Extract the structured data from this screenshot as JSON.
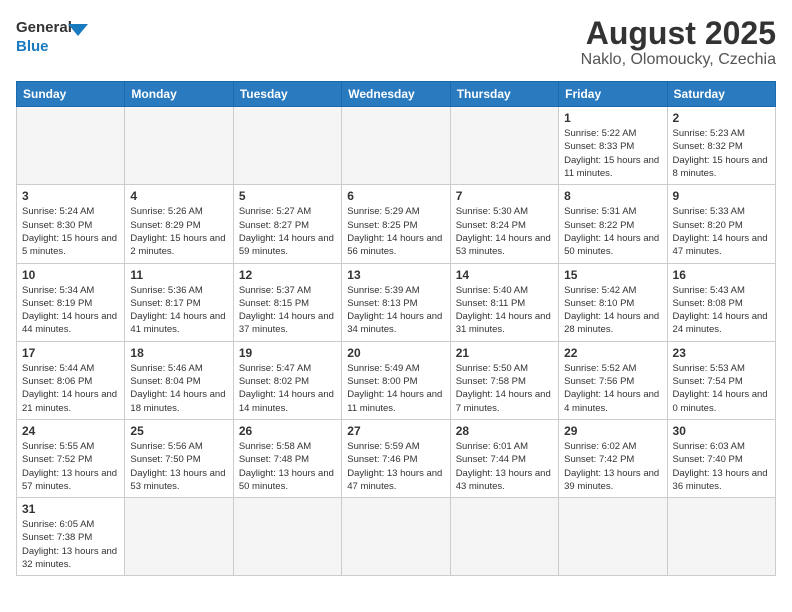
{
  "logo": {
    "general": "General",
    "blue": "Blue"
  },
  "header": {
    "title": "August 2025",
    "subtitle": "Naklo, Olomoucky, Czechia"
  },
  "weekdays": [
    "Sunday",
    "Monday",
    "Tuesday",
    "Wednesday",
    "Thursday",
    "Friday",
    "Saturday"
  ],
  "weeks": [
    [
      {
        "day": "",
        "info": ""
      },
      {
        "day": "",
        "info": ""
      },
      {
        "day": "",
        "info": ""
      },
      {
        "day": "",
        "info": ""
      },
      {
        "day": "",
        "info": ""
      },
      {
        "day": "1",
        "info": "Sunrise: 5:22 AM\nSunset: 8:33 PM\nDaylight: 15 hours and 11 minutes."
      },
      {
        "day": "2",
        "info": "Sunrise: 5:23 AM\nSunset: 8:32 PM\nDaylight: 15 hours and 8 minutes."
      }
    ],
    [
      {
        "day": "3",
        "info": "Sunrise: 5:24 AM\nSunset: 8:30 PM\nDaylight: 15 hours and 5 minutes."
      },
      {
        "day": "4",
        "info": "Sunrise: 5:26 AM\nSunset: 8:29 PM\nDaylight: 15 hours and 2 minutes."
      },
      {
        "day": "5",
        "info": "Sunrise: 5:27 AM\nSunset: 8:27 PM\nDaylight: 14 hours and 59 minutes."
      },
      {
        "day": "6",
        "info": "Sunrise: 5:29 AM\nSunset: 8:25 PM\nDaylight: 14 hours and 56 minutes."
      },
      {
        "day": "7",
        "info": "Sunrise: 5:30 AM\nSunset: 8:24 PM\nDaylight: 14 hours and 53 minutes."
      },
      {
        "day": "8",
        "info": "Sunrise: 5:31 AM\nSunset: 8:22 PM\nDaylight: 14 hours and 50 minutes."
      },
      {
        "day": "9",
        "info": "Sunrise: 5:33 AM\nSunset: 8:20 PM\nDaylight: 14 hours and 47 minutes."
      }
    ],
    [
      {
        "day": "10",
        "info": "Sunrise: 5:34 AM\nSunset: 8:19 PM\nDaylight: 14 hours and 44 minutes."
      },
      {
        "day": "11",
        "info": "Sunrise: 5:36 AM\nSunset: 8:17 PM\nDaylight: 14 hours and 41 minutes."
      },
      {
        "day": "12",
        "info": "Sunrise: 5:37 AM\nSunset: 8:15 PM\nDaylight: 14 hours and 37 minutes."
      },
      {
        "day": "13",
        "info": "Sunrise: 5:39 AM\nSunset: 8:13 PM\nDaylight: 14 hours and 34 minutes."
      },
      {
        "day": "14",
        "info": "Sunrise: 5:40 AM\nSunset: 8:11 PM\nDaylight: 14 hours and 31 minutes."
      },
      {
        "day": "15",
        "info": "Sunrise: 5:42 AM\nSunset: 8:10 PM\nDaylight: 14 hours and 28 minutes."
      },
      {
        "day": "16",
        "info": "Sunrise: 5:43 AM\nSunset: 8:08 PM\nDaylight: 14 hours and 24 minutes."
      }
    ],
    [
      {
        "day": "17",
        "info": "Sunrise: 5:44 AM\nSunset: 8:06 PM\nDaylight: 14 hours and 21 minutes."
      },
      {
        "day": "18",
        "info": "Sunrise: 5:46 AM\nSunset: 8:04 PM\nDaylight: 14 hours and 18 minutes."
      },
      {
        "day": "19",
        "info": "Sunrise: 5:47 AM\nSunset: 8:02 PM\nDaylight: 14 hours and 14 minutes."
      },
      {
        "day": "20",
        "info": "Sunrise: 5:49 AM\nSunset: 8:00 PM\nDaylight: 14 hours and 11 minutes."
      },
      {
        "day": "21",
        "info": "Sunrise: 5:50 AM\nSunset: 7:58 PM\nDaylight: 14 hours and 7 minutes."
      },
      {
        "day": "22",
        "info": "Sunrise: 5:52 AM\nSunset: 7:56 PM\nDaylight: 14 hours and 4 minutes."
      },
      {
        "day": "23",
        "info": "Sunrise: 5:53 AM\nSunset: 7:54 PM\nDaylight: 14 hours and 0 minutes."
      }
    ],
    [
      {
        "day": "24",
        "info": "Sunrise: 5:55 AM\nSunset: 7:52 PM\nDaylight: 13 hours and 57 minutes."
      },
      {
        "day": "25",
        "info": "Sunrise: 5:56 AM\nSunset: 7:50 PM\nDaylight: 13 hours and 53 minutes."
      },
      {
        "day": "26",
        "info": "Sunrise: 5:58 AM\nSunset: 7:48 PM\nDaylight: 13 hours and 50 minutes."
      },
      {
        "day": "27",
        "info": "Sunrise: 5:59 AM\nSunset: 7:46 PM\nDaylight: 13 hours and 47 minutes."
      },
      {
        "day": "28",
        "info": "Sunrise: 6:01 AM\nSunset: 7:44 PM\nDaylight: 13 hours and 43 minutes."
      },
      {
        "day": "29",
        "info": "Sunrise: 6:02 AM\nSunset: 7:42 PM\nDaylight: 13 hours and 39 minutes."
      },
      {
        "day": "30",
        "info": "Sunrise: 6:03 AM\nSunset: 7:40 PM\nDaylight: 13 hours and 36 minutes."
      }
    ],
    [
      {
        "day": "31",
        "info": "Sunrise: 6:05 AM\nSunset: 7:38 PM\nDaylight: 13 hours and 32 minutes."
      },
      {
        "day": "",
        "info": ""
      },
      {
        "day": "",
        "info": ""
      },
      {
        "day": "",
        "info": ""
      },
      {
        "day": "",
        "info": ""
      },
      {
        "day": "",
        "info": ""
      },
      {
        "day": "",
        "info": ""
      }
    ]
  ]
}
